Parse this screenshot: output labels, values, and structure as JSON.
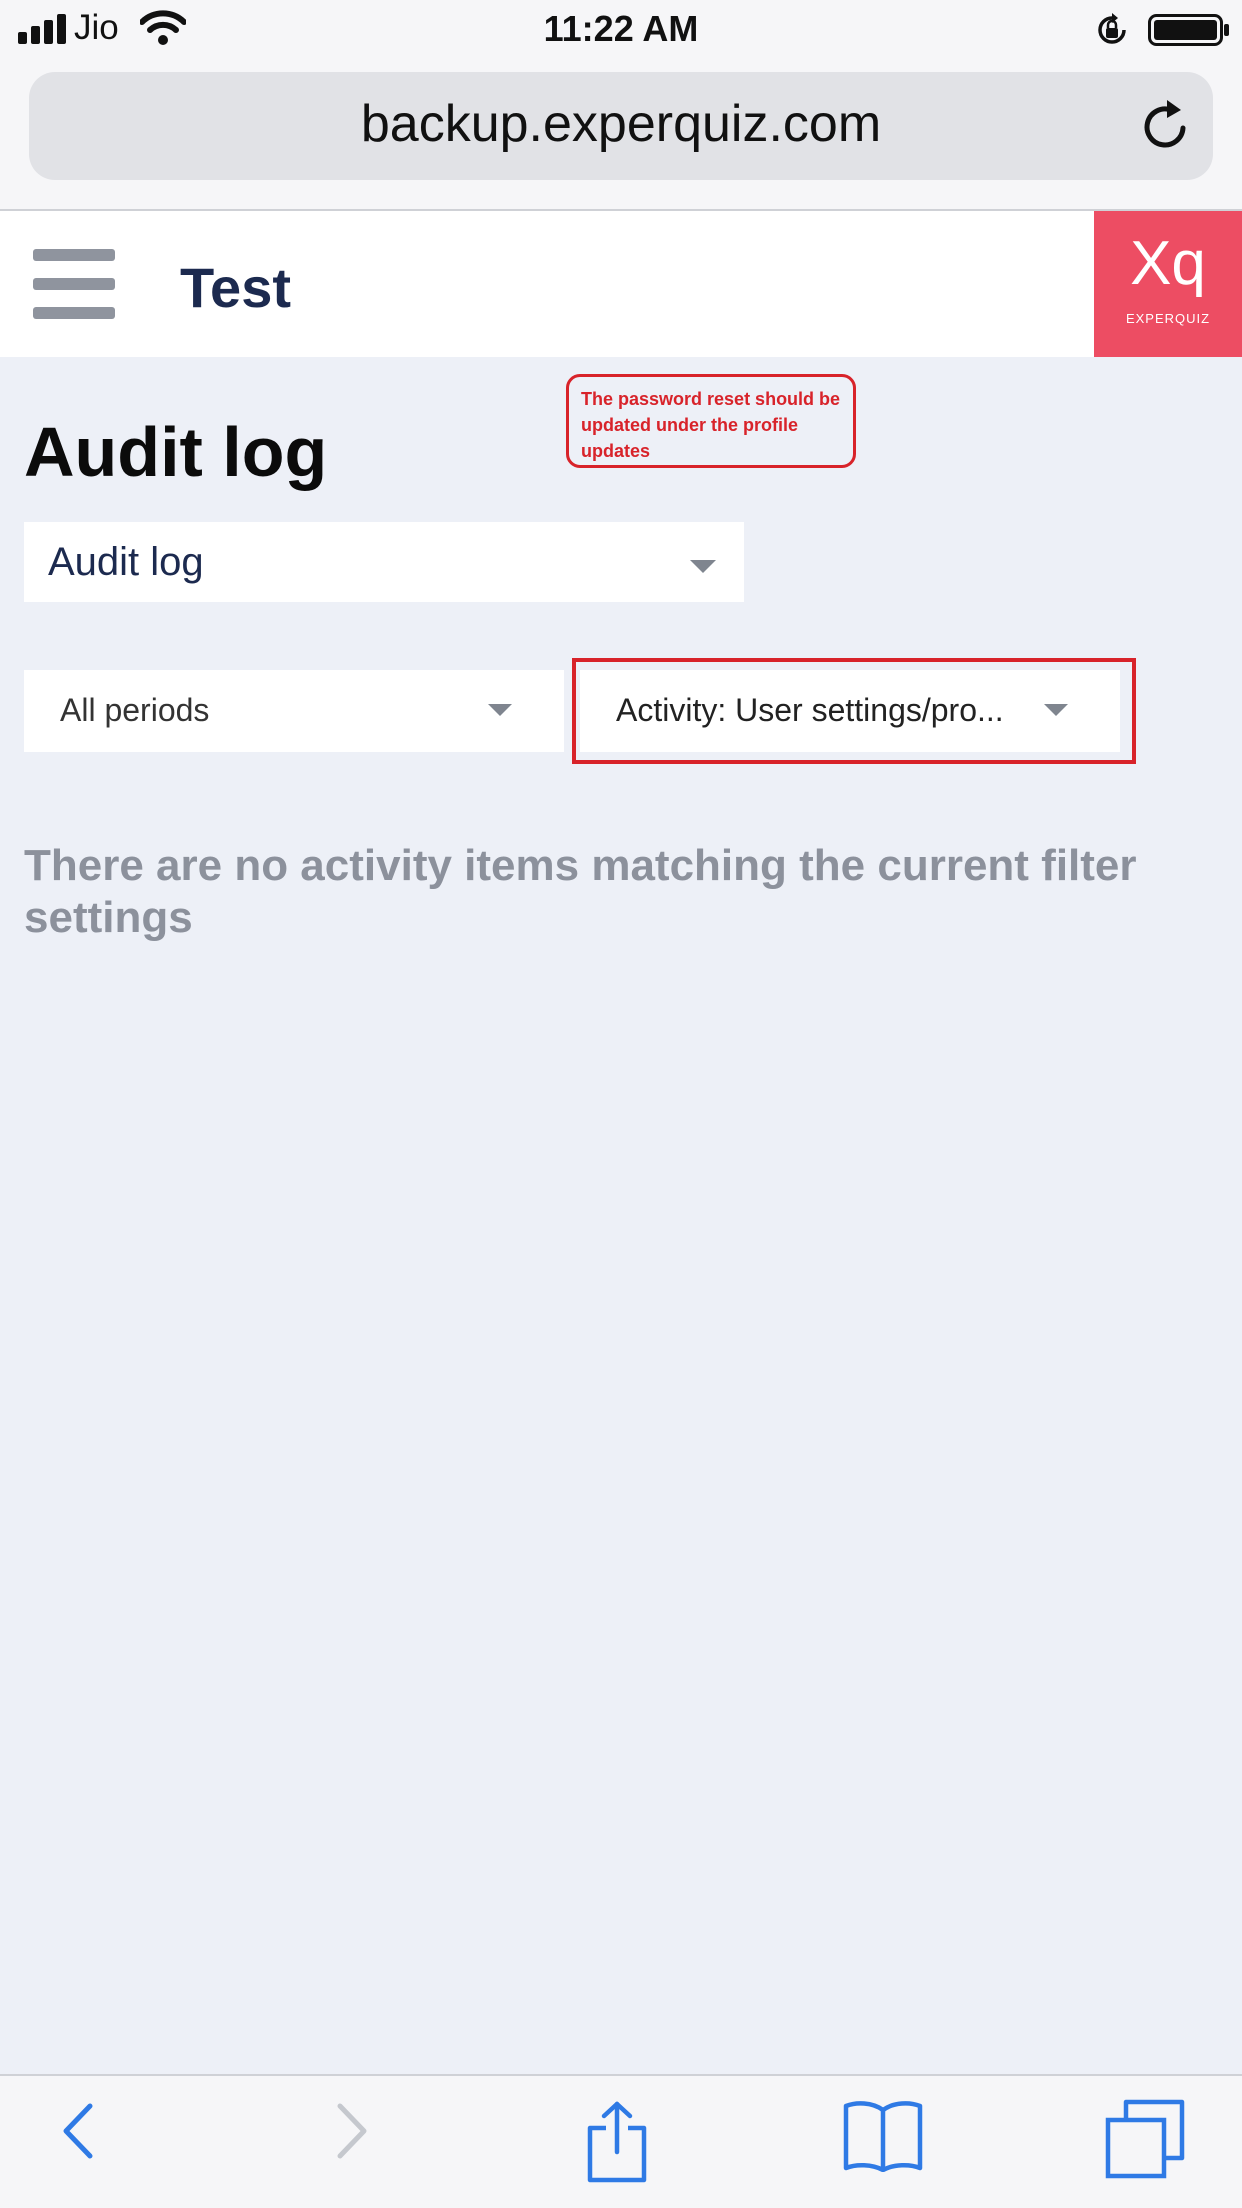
{
  "status_bar": {
    "carrier": "Jio",
    "time": "11:22 AM"
  },
  "browser": {
    "url": "backup.experquiz.com"
  },
  "header": {
    "title": "Test",
    "logo_mark": "Xq",
    "logo_text": "EXPERQUIZ"
  },
  "page": {
    "heading": "Audit log",
    "report_select": {
      "value": "Audit log"
    },
    "period_select": {
      "value": "All periods"
    },
    "activity_select": {
      "value": "Activity: User settings/pro..."
    },
    "empty_message": "There are no activity items matching the current filter settings"
  },
  "annotation": {
    "note": "The password reset should be updated under the profile updates"
  },
  "colors": {
    "brand": "#ed4d63",
    "page_background": "#edf0f7",
    "title_text": "#1c2a4f",
    "annotation": "#d8232a",
    "ios_accent": "#2f7ae5"
  },
  "icons": {
    "menu": "hamburger-menu-icon",
    "reload": "reload-icon",
    "back": "back-chevron-icon",
    "forward": "forward-chevron-icon",
    "share": "share-icon",
    "bookmarks": "bookmarks-icon",
    "tabs": "tabs-icon"
  }
}
